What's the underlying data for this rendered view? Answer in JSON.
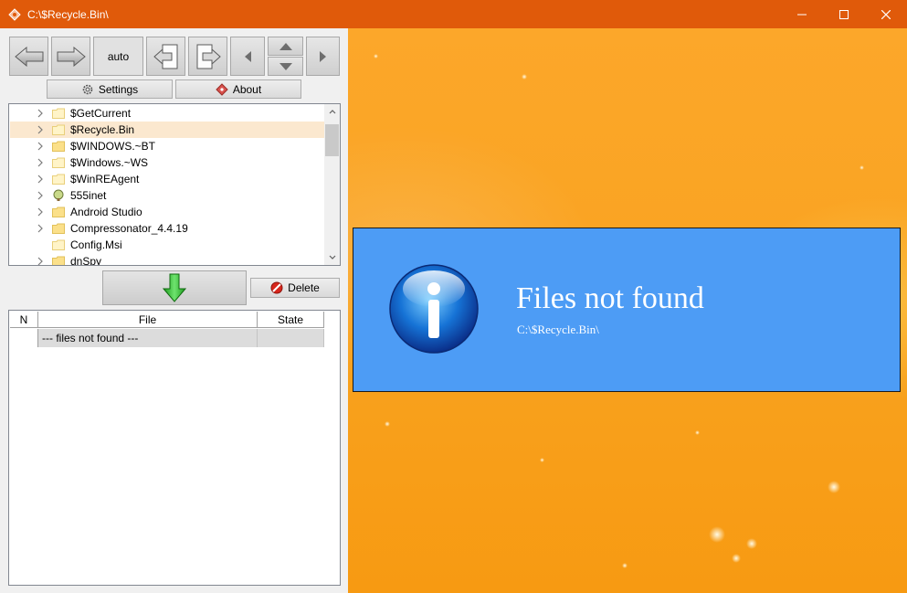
{
  "window": {
    "title": "C:\\$Recycle.Bin\\"
  },
  "toolbar": {
    "auto_label": "auto",
    "settings_label": "Settings",
    "about_label": "About",
    "delete_label": "Delete"
  },
  "tree": {
    "items": [
      {
        "label": "$GetCurrent",
        "expandable": true,
        "icon": "folder-icon"
      },
      {
        "label": "$Recycle.Bin",
        "expandable": true,
        "icon": "folder-icon",
        "selected": true
      },
      {
        "label": "$WINDOWS.~BT",
        "expandable": true,
        "icon": "folder-icon"
      },
      {
        "label": "$Windows.~WS",
        "expandable": true,
        "icon": "folder-icon"
      },
      {
        "label": "$WinREAgent",
        "expandable": true,
        "icon": "folder-icon"
      },
      {
        "label": "555inet",
        "expandable": true,
        "icon": "globe-icon"
      },
      {
        "label": "Android Studio",
        "expandable": true,
        "icon": "folder-icon"
      },
      {
        "label": "Compressonator_4.4.19",
        "expandable": true,
        "icon": "folder-icon"
      },
      {
        "label": "Config.Msi",
        "expandable": false,
        "icon": "folder-icon"
      },
      {
        "label": "dnSpy",
        "expandable": true,
        "icon": "folder-icon"
      }
    ]
  },
  "grid": {
    "columns": [
      "N",
      "File",
      "State"
    ],
    "rows": [
      {
        "n": "",
        "file": "--- files not found ---",
        "state": ""
      }
    ]
  },
  "info": {
    "title": "Files not found",
    "path": "C:\\$Recycle.Bin\\"
  },
  "colors": {
    "titlebar": "#e05a0a",
    "info_box": "#4d9cf5",
    "selection": "#fbe8cf"
  }
}
